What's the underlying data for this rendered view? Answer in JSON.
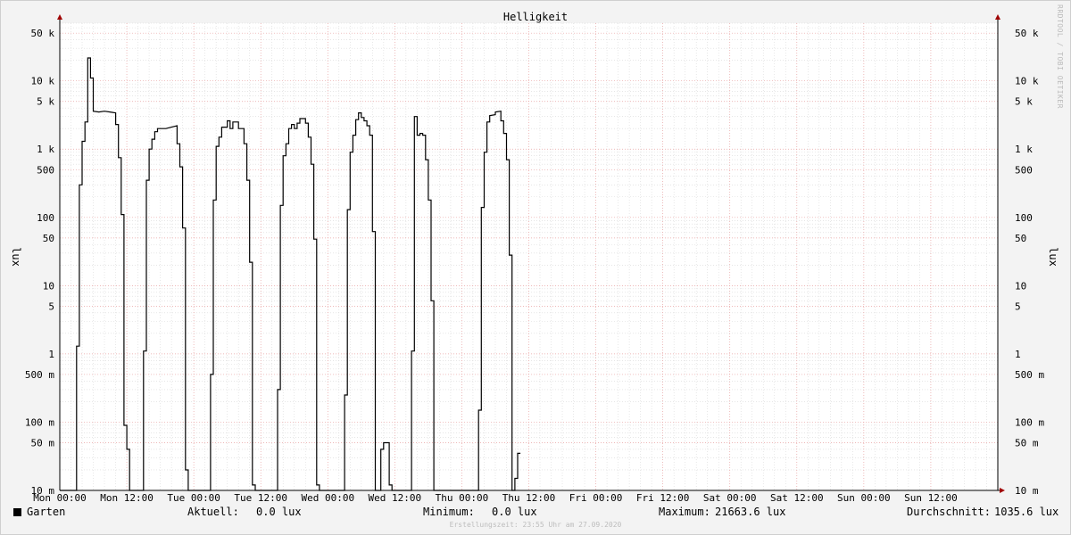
{
  "chart_data": {
    "type": "line",
    "title": "Helligkeit",
    "ylabel": "lux",
    "yscale": "log",
    "ylim": [
      0.01,
      70000
    ],
    "x_range_hours": [
      0,
      168
    ],
    "y_ticks": [
      {
        "v": 50000,
        "label": "50 k"
      },
      {
        "v": 10000,
        "label": "10 k"
      },
      {
        "v": 5000,
        "label": "5 k"
      },
      {
        "v": 1000,
        "label": "1 k"
      },
      {
        "v": 500,
        "label": "500"
      },
      {
        "v": 100,
        "label": "100"
      },
      {
        "v": 50,
        "label": "50"
      },
      {
        "v": 10,
        "label": "10"
      },
      {
        "v": 5,
        "label": "5"
      },
      {
        "v": 1,
        "label": "1"
      },
      {
        "v": 0.5,
        "label": "500 m"
      },
      {
        "v": 0.1,
        "label": "100 m"
      },
      {
        "v": 0.05,
        "label": "50 m"
      },
      {
        "v": 0.01,
        "label": "10 m"
      }
    ],
    "x_ticks": [
      {
        "h": 0,
        "label": "Mon 00:00"
      },
      {
        "h": 12,
        "label": "Mon 12:00"
      },
      {
        "h": 24,
        "label": "Tue 00:00"
      },
      {
        "h": 36,
        "label": "Tue 12:00"
      },
      {
        "h": 48,
        "label": "Wed 00:00"
      },
      {
        "h": 60,
        "label": "Wed 12:00"
      },
      {
        "h": 72,
        "label": "Thu 00:00"
      },
      {
        "h": 84,
        "label": "Thu 12:00"
      },
      {
        "h": 96,
        "label": "Fri 00:00"
      },
      {
        "h": 108,
        "label": "Fri 12:00"
      },
      {
        "h": 120,
        "label": "Sat 00:00"
      },
      {
        "h": 132,
        "label": "Sat 12:00"
      },
      {
        "h": 144,
        "label": "Sun 00:00"
      },
      {
        "h": 156,
        "label": "Sun 12:00"
      }
    ],
    "grid": true,
    "series": [
      {
        "name": "Garten",
        "color": "#000000",
        "points": [
          [
            0,
            0.01
          ],
          [
            3,
            0.01
          ],
          [
            3,
            1.3
          ],
          [
            3.5,
            1.3
          ],
          [
            3.5,
            300
          ],
          [
            4,
            300
          ],
          [
            4,
            1300
          ],
          [
            4.5,
            1300
          ],
          [
            4.5,
            2500
          ],
          [
            5,
            2500
          ],
          [
            5,
            21663.6
          ],
          [
            5.5,
            21663.6
          ],
          [
            5.5,
            11000
          ],
          [
            6,
            11000
          ],
          [
            6,
            3600
          ],
          [
            7,
            3500
          ],
          [
            8,
            3600
          ],
          [
            9,
            3500
          ],
          [
            10,
            3400
          ],
          [
            10,
            2300
          ],
          [
            10.5,
            2300
          ],
          [
            10.5,
            750
          ],
          [
            11,
            750
          ],
          [
            11,
            110
          ],
          [
            11.5,
            110
          ],
          [
            11.5,
            0.09
          ],
          [
            12,
            0.09
          ],
          [
            12,
            0.04
          ],
          [
            12.5,
            0.04
          ],
          [
            12.5,
            0.01
          ],
          [
            15,
            0.01
          ],
          [
            15,
            1.1
          ],
          [
            15.5,
            1.1
          ],
          [
            15.5,
            350
          ],
          [
            16,
            350
          ],
          [
            16,
            1000
          ],
          [
            16.5,
            1000
          ],
          [
            16.5,
            1400
          ],
          [
            17,
            1400
          ],
          [
            17,
            1800
          ],
          [
            17.5,
            1800
          ],
          [
            17.5,
            2000
          ],
          [
            19,
            2000
          ],
          [
            20,
            2100
          ],
          [
            21,
            2200
          ],
          [
            21,
            1200
          ],
          [
            21.5,
            1200
          ],
          [
            21.5,
            550
          ],
          [
            22,
            550
          ],
          [
            22,
            70
          ],
          [
            22.5,
            70
          ],
          [
            22.5,
            0.02
          ],
          [
            23,
            0.02
          ],
          [
            23,
            0.01
          ],
          [
            27,
            0.01
          ],
          [
            27,
            0.5
          ],
          [
            27.5,
            0.5
          ],
          [
            27.5,
            180
          ],
          [
            28,
            180
          ],
          [
            28,
            1100
          ],
          [
            28.5,
            1100
          ],
          [
            28.5,
            1500
          ],
          [
            29,
            1500
          ],
          [
            29,
            2100
          ],
          [
            30,
            2100
          ],
          [
            30,
            2600
          ],
          [
            30.5,
            2600
          ],
          [
            30.5,
            2000
          ],
          [
            31,
            2000
          ],
          [
            31,
            2500
          ],
          [
            32,
            2500
          ],
          [
            32,
            2000
          ],
          [
            33,
            2000
          ],
          [
            33,
            1200
          ],
          [
            33.5,
            1200
          ],
          [
            33.5,
            350
          ],
          [
            34,
            350
          ],
          [
            34,
            22
          ],
          [
            34.5,
            22
          ],
          [
            34.5,
            0.012
          ],
          [
            35,
            0.012
          ],
          [
            35,
            0.01
          ],
          [
            39,
            0.01
          ],
          [
            39,
            0.3
          ],
          [
            39.5,
            0.3
          ],
          [
            39.5,
            150
          ],
          [
            40,
            150
          ],
          [
            40,
            800
          ],
          [
            40.5,
            800
          ],
          [
            40.5,
            1200
          ],
          [
            41,
            1200
          ],
          [
            41,
            2000
          ],
          [
            41.5,
            2000
          ],
          [
            41.5,
            2300
          ],
          [
            42,
            2300
          ],
          [
            42,
            2000
          ],
          [
            42.5,
            2000
          ],
          [
            42.5,
            2400
          ],
          [
            43,
            2400
          ],
          [
            43,
            2800
          ],
          [
            44,
            2800
          ],
          [
            44,
            2400
          ],
          [
            44.5,
            2400
          ],
          [
            44.5,
            1500
          ],
          [
            45,
            1500
          ],
          [
            45,
            600
          ],
          [
            45.5,
            600
          ],
          [
            45.5,
            48
          ],
          [
            46,
            48
          ],
          [
            46,
            0.012
          ],
          [
            46.5,
            0.012
          ],
          [
            46.5,
            0.01
          ],
          [
            51,
            0.01
          ],
          [
            51,
            0.25
          ],
          [
            51.5,
            0.25
          ],
          [
            51.5,
            130
          ],
          [
            52,
            130
          ],
          [
            52,
            900
          ],
          [
            52.5,
            900
          ],
          [
            52.5,
            1600
          ],
          [
            53,
            1600
          ],
          [
            53,
            2700
          ],
          [
            53.5,
            2700
          ],
          [
            53.5,
            3400
          ],
          [
            54,
            3400
          ],
          [
            54,
            2900
          ],
          [
            54.5,
            2900
          ],
          [
            54.5,
            2600
          ],
          [
            55,
            2600
          ],
          [
            55,
            2200
          ],
          [
            55.5,
            2200
          ],
          [
            55.5,
            1600
          ],
          [
            56,
            1600
          ],
          [
            56,
            62
          ],
          [
            56.5,
            62
          ],
          [
            56.5,
            0.01
          ],
          [
            57.5,
            0.01
          ],
          [
            57.5,
            0.04
          ],
          [
            58,
            0.04
          ],
          [
            58,
            0.05
          ],
          [
            59,
            0.05
          ],
          [
            59,
            0.012
          ],
          [
            59.5,
            0.012
          ],
          [
            59.5,
            0.01
          ],
          [
            63,
            0.01
          ],
          [
            63,
            1.1
          ],
          [
            63.5,
            1.1
          ],
          [
            63.5,
            3000
          ],
          [
            64,
            3000
          ],
          [
            64,
            1600
          ],
          [
            64.5,
            1600
          ],
          [
            64.5,
            1700
          ],
          [
            65,
            1700
          ],
          [
            65,
            1600
          ],
          [
            65.5,
            1600
          ],
          [
            65.5,
            700
          ],
          [
            66,
            700
          ],
          [
            66,
            180
          ],
          [
            66.5,
            180
          ],
          [
            66.5,
            6
          ],
          [
            67,
            6
          ],
          [
            67,
            0.01
          ],
          [
            75,
            0.01
          ],
          [
            75,
            0.15
          ],
          [
            75.5,
            0.15
          ],
          [
            75.5,
            140
          ],
          [
            76,
            140
          ],
          [
            76,
            900
          ],
          [
            76.5,
            900
          ],
          [
            76.5,
            2500
          ],
          [
            77,
            2500
          ],
          [
            77,
            3100
          ],
          [
            78,
            3200
          ],
          [
            78,
            3500
          ],
          [
            79,
            3600
          ],
          [
            79,
            2600
          ],
          [
            79.5,
            2600
          ],
          [
            79.5,
            1700
          ],
          [
            80,
            1700
          ],
          [
            80,
            700
          ],
          [
            80.5,
            700
          ],
          [
            80.5,
            28
          ],
          [
            81,
            28
          ],
          [
            81,
            0.01
          ],
          [
            81.5,
            0.01
          ],
          [
            81.5,
            0.015
          ],
          [
            82,
            0.015
          ],
          [
            82,
            0.035
          ],
          [
            82.5,
            0.035
          ]
        ]
      }
    ],
    "legend": [
      {
        "label": "Garten",
        "color": "#000000"
      }
    ]
  },
  "stats": {
    "aktuell_label": "Aktuell:",
    "aktuell_value": "0.0 lux",
    "minimum_label": "Minimum:",
    "minimum_value": "0.0 lux",
    "maximum_label": "Maximum:",
    "maximum_value": "21663.6 lux",
    "durchschnitt_label": "Durchschnitt:",
    "durchschnitt_value": "1035.6 lux"
  },
  "footer": "Erstellungszeit: 23:55 Uhr am 27.09.2020",
  "credit": "RRDTOOL / TOBI OETIKER",
  "colors": {
    "background": "#f3f3f3",
    "plot_bg": "#ffffff",
    "grid_major": "#e8a0a0",
    "grid_minor": "#d8d8d8",
    "line": "#000000",
    "arrow": "#a00000"
  }
}
